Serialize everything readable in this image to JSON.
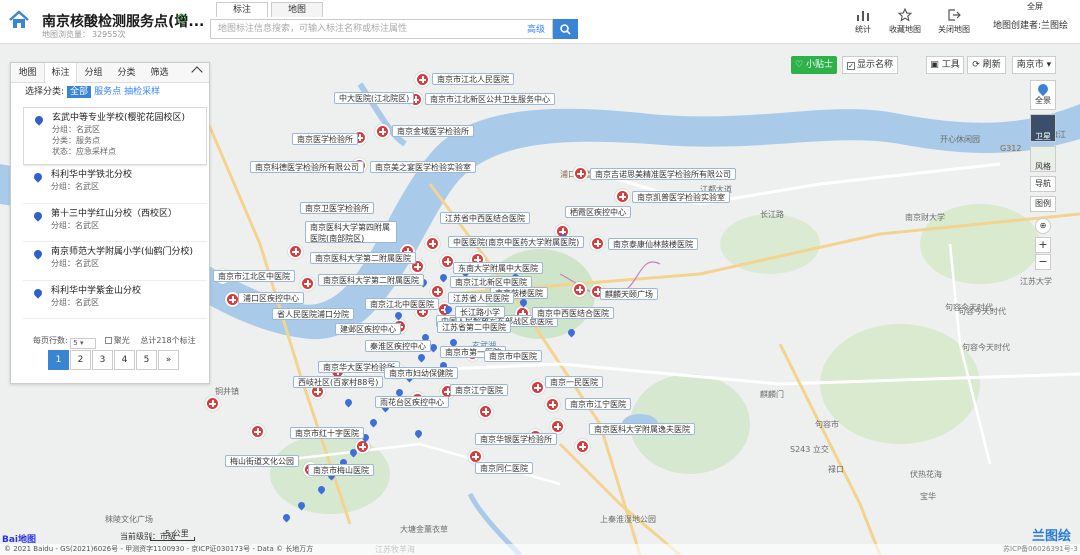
{
  "header": {
    "title": "南京核酸检测服务点(增...",
    "views_label": "地图浏览量：",
    "views_count": "32955次",
    "tabs": [
      "标注",
      "地图"
    ],
    "search_placeholder": "地图标注信息搜索，可输入标注名称或标注属性",
    "advanced_label": "高级",
    "buttons": {
      "stats": "统计",
      "favorite": "收藏地图",
      "close": "关闭地图"
    },
    "creator": "地图创建者:兰图绘",
    "fullscreen": "全屏"
  },
  "panel": {
    "tabs": [
      "地图",
      "标注",
      "分组",
      "分类",
      "筛选"
    ],
    "filter_label": "选择分类:",
    "filter_options": [
      "全部",
      "服务点",
      "抽检采样"
    ],
    "items": [
      {
        "name": "玄武中等专业学校(樱驼花园校区)",
        "lines": [
          "分组：名武区",
          "分类：服务点",
          "状态：应急采样点"
        ]
      },
      {
        "name": "科利华中学铁北分校",
        "lines": [
          "分组：名武区"
        ]
      },
      {
        "name": "第十三中学红山分校（西校区）",
        "lines": [
          "分组：名武区"
        ]
      },
      {
        "name": "南京师范大学附属小学(仙鹤门分校)",
        "lines": [
          "分组：名武区"
        ]
      },
      {
        "name": "科利华中学紫金山分校",
        "lines": [
          "分组：名武区"
        ]
      }
    ],
    "per_page_label": "每页行数:",
    "per_page_value": "5",
    "cluster_label": "聚光",
    "total_label": "总计218个标注",
    "pages": [
      "1",
      "2",
      "3",
      "4",
      "5",
      "»"
    ]
  },
  "map_controls": {
    "tip": "小贴士",
    "show_names": "显示名称",
    "tools": "工具",
    "refresh": "刷新",
    "city": "南京市",
    "right_tools": [
      "全景",
      "卫星",
      "风格",
      "导航",
      "图例"
    ],
    "scale_level": "当前级别：市级",
    "scale_km": "5 公里",
    "copyright": "© 2021 Baidu - GS(2021)6026号 - 甲测资字1100930 - 京ICP证030173号 - Data © 长地万方",
    "icp": "苏ICP备06026391号-3",
    "brand": "兰图绘",
    "baidu": "Bai地图"
  },
  "place_labels": [
    "南京市江北人民医院",
    "中大医院(江北院区)",
    "南京市江北新区公共卫生服务中心",
    "南京金域医学检验所",
    "南京医学检验所",
    "南京科德医学检验所有限公司",
    "南京美之宴医学检验实验室",
    "南京吉诺思美精准医学检验所有限公司",
    "南京凯普医学检验实验室",
    "南京卫医学检验所",
    "南京医科大学第四附属医院(南部院区)",
    "江苏省中西医结合医院",
    "栖霞区疾控中心",
    "中医医院(南京中医药大学附属医院)",
    "南京泰康仙林鼓楼医院",
    "东南大学附属中大医院",
    "南京医科大学第二附属医院",
    "南京市江北区中医院",
    "南京鼓楼医院",
    "南京医科大学第二附属医院",
    "浦口区疾控中心",
    "南京江北新区中医院",
    "省人民医院浦口分院",
    "江苏省人民医院",
    "南京江北中医医院",
    "中国人民解放军东部战区总医院",
    "南京中西医结合医院",
    "麒麟天颐广场",
    "建邺区疾控中心",
    "长江路小学",
    "江苏省第二中医院",
    "南京市第一医院",
    "南京市中医院",
    "秦淮区疾控中心",
    "南京华大医学检验所",
    "南京市妇幼保健院",
    "南京江宁医院",
    "西岐社区(百家村88号)",
    "南京市红十字医院",
    "南京一民医院",
    "南京市江宁医院",
    "南京医科大学附属逸夫医院",
    "南京华银医学检验所",
    "雨花台区疾控中心",
    "梅山街道文化公园",
    "南京市梅山医院",
    "南京同仁医院"
  ]
}
